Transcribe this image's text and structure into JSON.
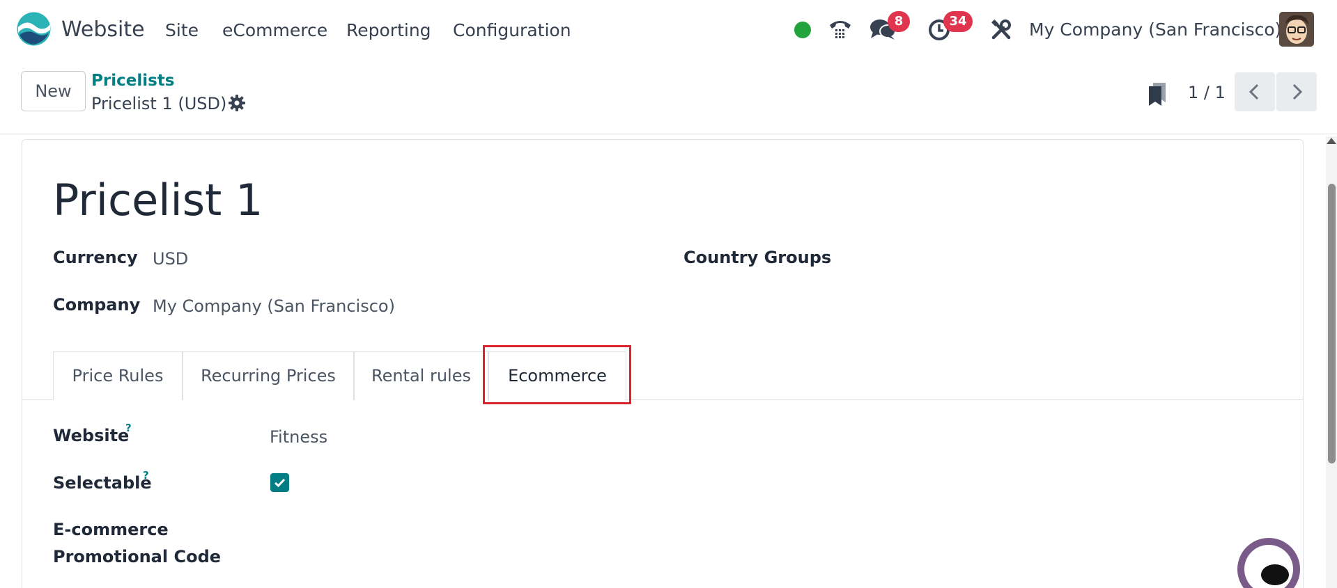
{
  "navbar": {
    "app_name": "Website",
    "menus": [
      "Site",
      "eCommerce",
      "Reporting",
      "Configuration"
    ],
    "messages_count": "8",
    "activities_count": "34",
    "company": "My Company (San Francisco)",
    "icons": [
      "app-logo-icon",
      "phone-icon",
      "chat-icon",
      "clock-icon",
      "tools-icon"
    ],
    "status_color": "#22a33b",
    "badge_color": "#e0344f"
  },
  "control_panel": {
    "new_label": "New",
    "breadcrumb": "Pricelists",
    "record_name": "Pricelist 1 (USD)",
    "pager": "1 / 1"
  },
  "form": {
    "title": "Pricelist 1",
    "currency_label": "Currency",
    "currency_value": "USD",
    "company_label": "Company",
    "company_value": "My Company (San Francisco)",
    "country_groups_label": "Country Groups",
    "tabs": [
      {
        "label": "Price Rules",
        "active": false
      },
      {
        "label": "Recurring Prices",
        "active": false
      },
      {
        "label": "Rental rules",
        "active": false
      },
      {
        "label": "Ecommerce",
        "active": true
      }
    ],
    "website_label": "Website",
    "website_help": "?",
    "website_value": "Fitness",
    "selectable_label": "Selectable",
    "selectable_help": "?",
    "selectable_checked": true,
    "promo_label_line1": "E-commerce",
    "promo_label_line2": "Promotional Code"
  },
  "colors": {
    "accent": "#017e84",
    "highlight": "#d9242e"
  }
}
